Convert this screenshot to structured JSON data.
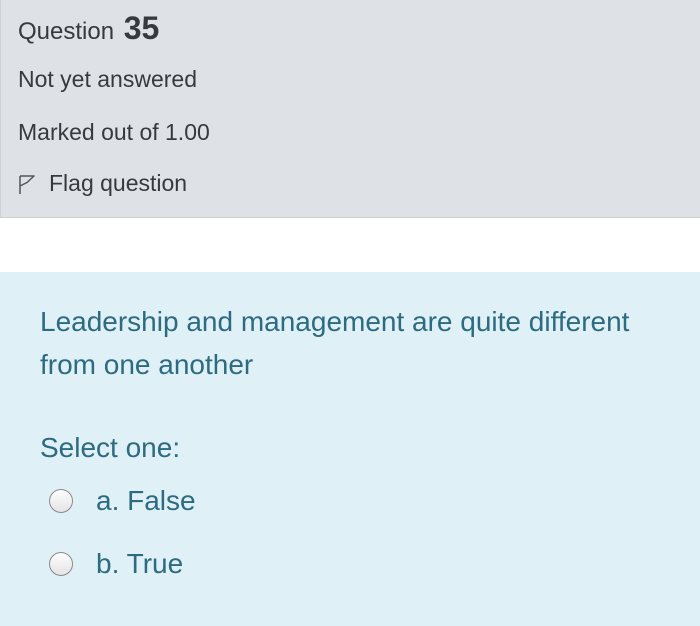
{
  "question": {
    "label": "Question",
    "number": "35",
    "state": "Not yet answered",
    "grade": "Marked out of 1.00",
    "flag_label": "Flag question"
  },
  "content": {
    "text": "Leadership and management are quite different from one another",
    "prompt": "Select one:",
    "answers": [
      {
        "label": "a. False",
        "selected": false
      },
      {
        "label": "b. True",
        "selected": false
      }
    ]
  },
  "colors": {
    "info_bg": "#dee2e6",
    "content_bg": "#dff0f6",
    "content_text": "#2c6b80",
    "info_text": "#373a3c"
  },
  "icons": {
    "flag": "flag-outline-icon",
    "radio": "radio-unchecked"
  }
}
